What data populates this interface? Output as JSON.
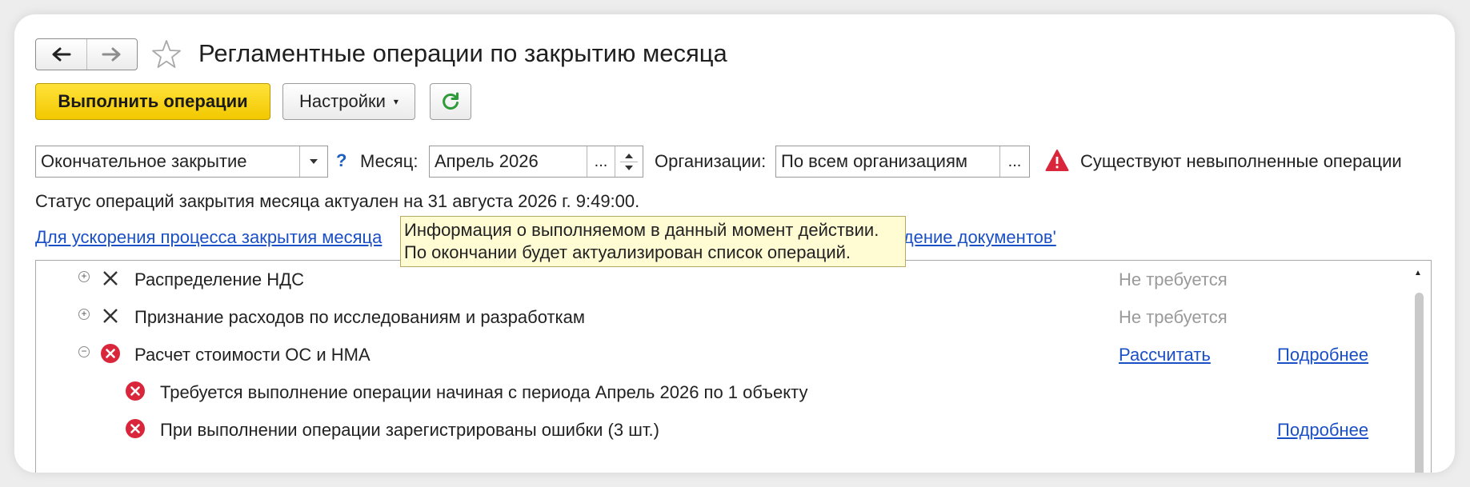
{
  "window": {
    "title": "Регламентные операции по закрытию месяца"
  },
  "toolbar": {
    "run_label": "Выполнить операции",
    "settings_label": "Настройки"
  },
  "filters": {
    "closing_type": "Окончательное закрытие",
    "help": "?",
    "month_label": "Месяц:",
    "month_value": "Апрель 2026",
    "org_label": "Организации:",
    "org_value": "По всем организациям",
    "ellipsis": "...",
    "warning_text": "Существуют невыполненные операции"
  },
  "status_text": "Статус операций закрытия месяца актуален на 31 августа 2026 г. 9:49:00.",
  "hint_link_start": "Для ускорения процесса закрытия месяца",
  "hint_link_end": "едение документов'",
  "tooltip": {
    "line1": "Информация о выполняемом в данный момент действии.",
    "line2": "По окончании будет актуализирован список операций."
  },
  "operations": [
    {
      "label": "Распределение НДС",
      "state": "Не требуется"
    },
    {
      "label": "Признание расходов по исследованиям и разработкам",
      "state": "Не требуется"
    },
    {
      "label": "Расчет стоимости ОС и НМА",
      "action": "Рассчитать",
      "more": "Подробнее"
    },
    {
      "label": "Требуется выполнение операции начиная с периода Апрель 2026 по 1 объекту"
    },
    {
      "label": "При выполнении операции зарегистрированы ошибки (3 шт.)",
      "more": "Подробнее"
    }
  ],
  "colors": {
    "primary": "#f2c800",
    "link": "#1a4fc6",
    "error": "#d9263b",
    "refresh": "#2e9a3a"
  }
}
